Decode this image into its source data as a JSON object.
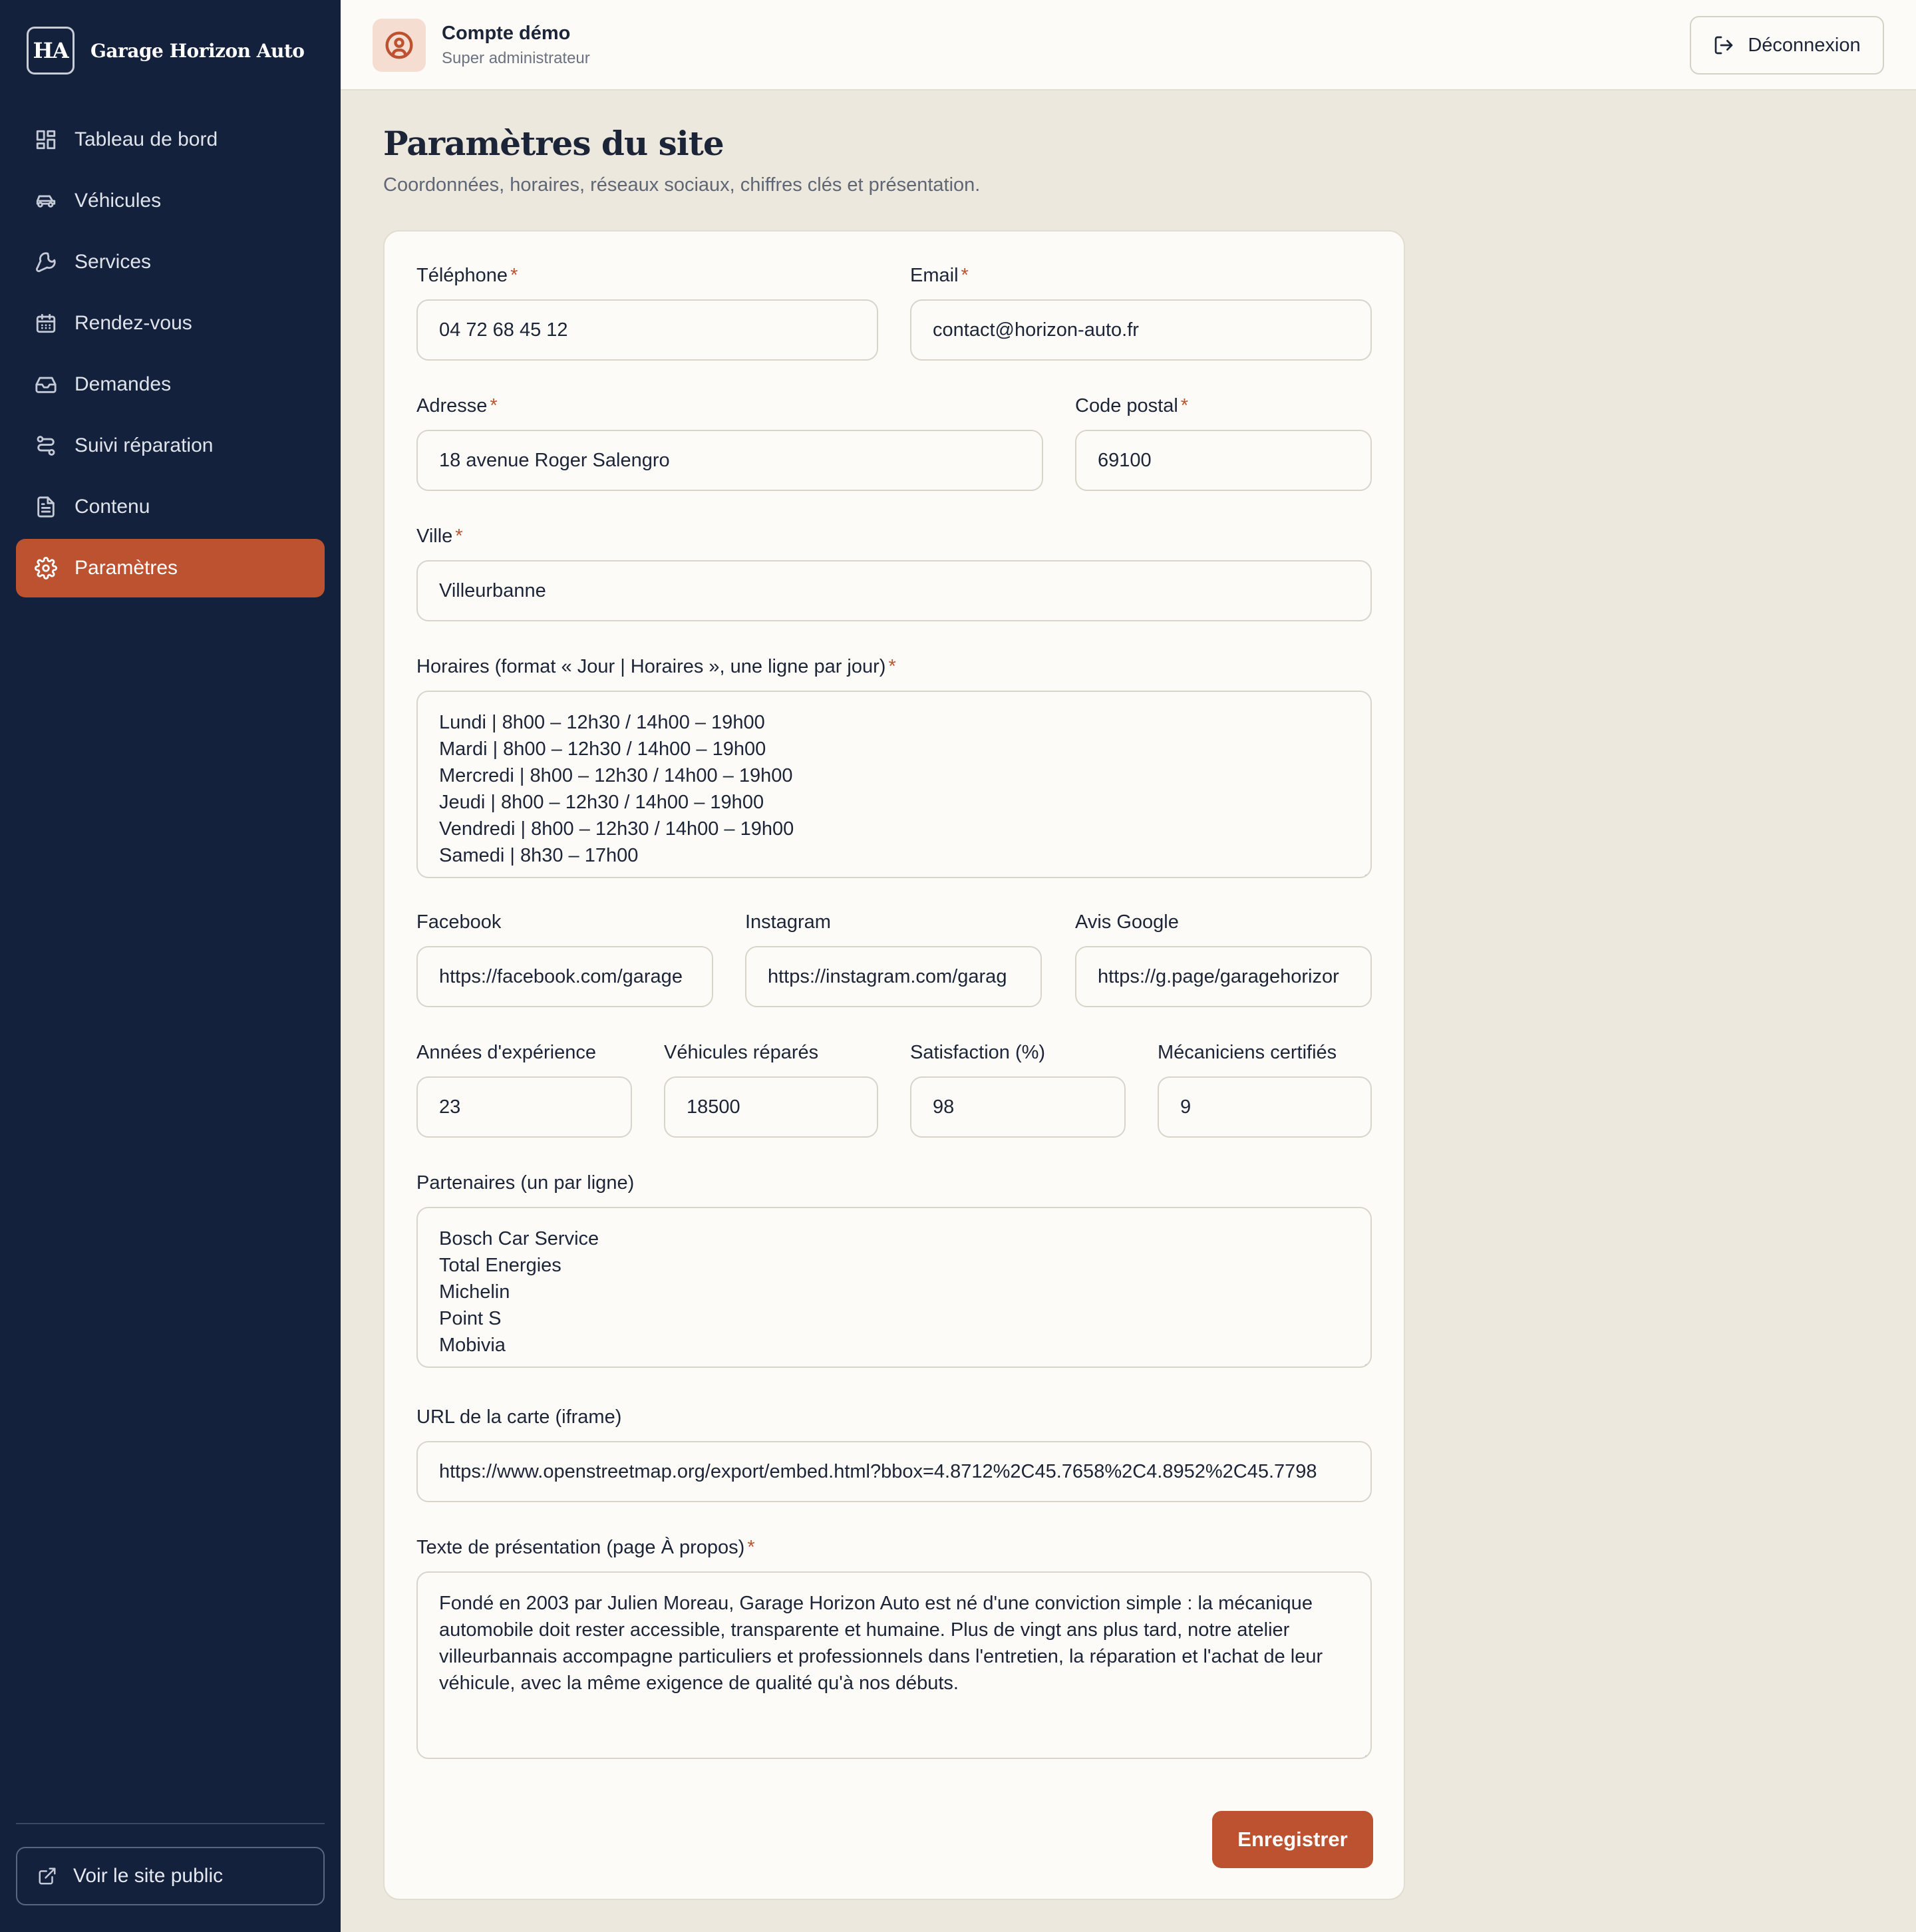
{
  "brand": {
    "mark": "HA",
    "name": "Garage Horizon Auto"
  },
  "nav": {
    "items": [
      {
        "label": "Tableau de bord",
        "icon": "dashboard-icon"
      },
      {
        "label": "Véhicules",
        "icon": "car-icon"
      },
      {
        "label": "Services",
        "icon": "wrench-icon"
      },
      {
        "label": "Rendez-vous",
        "icon": "calendar-icon"
      },
      {
        "label": "Demandes",
        "icon": "inbox-icon"
      },
      {
        "label": "Suivi réparation",
        "icon": "route-icon"
      },
      {
        "label": "Contenu",
        "icon": "document-icon"
      },
      {
        "label": "Paramètres",
        "icon": "gear-icon",
        "active": true
      }
    ],
    "public_link": "Voir le site public"
  },
  "user": {
    "name": "Compte démo",
    "role": "Super administrateur"
  },
  "topbar": {
    "logout_label": "Déconnexion"
  },
  "page": {
    "title": "Paramètres du site",
    "subtitle": "Coordonnées, horaires, réseaux sociaux, chiffres clés et présentation."
  },
  "form": {
    "phone": {
      "label": "Téléphone",
      "value": "04 72 68 45 12",
      "required": true
    },
    "email": {
      "label": "Email",
      "value": "contact@horizon-auto.fr",
      "required": true
    },
    "address": {
      "label": "Adresse",
      "value": "18 avenue Roger Salengro",
      "required": true
    },
    "postal_code": {
      "label": "Code postal",
      "value": "69100",
      "required": true
    },
    "city": {
      "label": "Ville",
      "value": "Villeurbanne",
      "required": true
    },
    "hours": {
      "label": "Horaires (format « Jour | Horaires », une ligne par jour)",
      "required": true,
      "lines": [
        "Lundi | 8h00 – 12h30 / 14h00 – 19h00",
        "Mardi | 8h00 – 12h30 / 14h00 – 19h00",
        "Mercredi | 8h00 – 12h30 / 14h00 – 19h00",
        "Jeudi | 8h00 – 12h30 / 14h00 – 19h00",
        "Vendredi | 8h00 – 12h30 / 14h00 – 19h00",
        "Samedi | 8h30 – 17h00"
      ]
    },
    "facebook": {
      "label": "Facebook",
      "value": "https://facebook.com/garage"
    },
    "instagram": {
      "label": "Instagram",
      "value": "https://instagram.com/garag"
    },
    "google": {
      "label": "Avis Google",
      "value": "https://g.page/garagehorizor"
    },
    "years": {
      "label": "Années d'expérience",
      "value": "23"
    },
    "vehicles": {
      "label": "Véhicules réparés",
      "value": "18500"
    },
    "satisfaction": {
      "label": "Satisfaction (%)",
      "value": "98"
    },
    "mechanics": {
      "label": "Mécaniciens certifiés",
      "value": "9"
    },
    "partners": {
      "label": "Partenaires (un par ligne)",
      "lines": [
        "Bosch Car Service",
        "Total Energies",
        "Michelin",
        "Point S",
        "Mobivia"
      ]
    },
    "map_url": {
      "label": "URL de la carte (iframe)",
      "value": "https://www.openstreetmap.org/export/embed.html?bbox=4.8712%2C45.7658%2C4.8952%2C45.7798"
    },
    "about": {
      "label": "Texte de présentation (page À propos)",
      "required": true,
      "value": "Fondé en 2003 par Julien Moreau, Garage Horizon Auto est né d'une conviction simple : la mécanique automobile doit rester accessible, transparente et humaine. Plus de vingt ans plus tard, notre atelier villeurbannais accompagne particuliers et professionnels dans l'entretien, la réparation et l'achat de leur véhicule, avec la même exigence de qualité qu'à nos débuts."
    },
    "save_label": "Enregistrer"
  },
  "colors": {
    "sidebar": "#14213d",
    "accent": "#bd5230",
    "page_background": "#ede8de",
    "card_background": "#fdfbf7"
  }
}
